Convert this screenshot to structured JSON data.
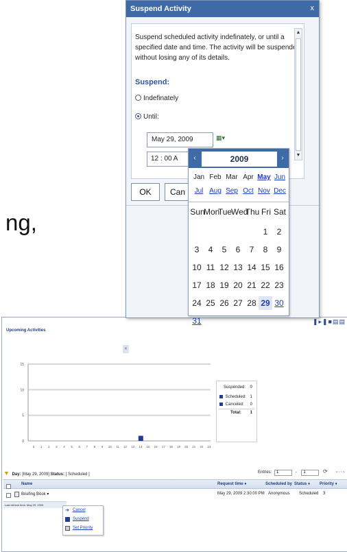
{
  "background": {
    "slide_text": "ng,"
  },
  "dialog": {
    "title": "Suspend Activity",
    "close": "x",
    "description": "Suspend scheduled activity indefinately, or until a specified date and time. The activity will be suspended without losing any of its details.",
    "suspend_label": "Suspend:",
    "options": [
      {
        "label": "Indefinately",
        "selected": false
      },
      {
        "label": "Until:",
        "selected": true
      }
    ],
    "date_value": "May 29, 2009",
    "time_value": "12  :  00    A",
    "buttons": {
      "ok": "OK",
      "cancel_partial": "Can"
    }
  },
  "calendar": {
    "year": "2009",
    "prev_arrow": "‹",
    "next_arrow": "›",
    "months_row1": [
      "Jan",
      "Feb",
      "Mar",
      "Apr",
      "May",
      "Jun"
    ],
    "months_row2": [
      "Jul",
      "Aug",
      "Sep",
      "Oct",
      "Nov",
      "Dec"
    ],
    "selected_month": "May",
    "weekdays": [
      "Sun",
      "Mon",
      "Tue",
      "Wed",
      "Thu",
      "Fri",
      "Sat"
    ],
    "weeks": [
      [
        "",
        "",
        "",
        "",
        "",
        "1",
        "2"
      ],
      [
        "3",
        "4",
        "5",
        "6",
        "7",
        "8",
        "9"
      ],
      [
        "10",
        "11",
        "12",
        "13",
        "14",
        "15",
        "16"
      ],
      [
        "17",
        "18",
        "19",
        "20",
        "21",
        "22",
        "23"
      ],
      [
        "24",
        "25",
        "26",
        "27",
        "28",
        "29",
        "30"
      ],
      [
        "31",
        "",
        "",
        "",
        "",
        "",
        ""
      ]
    ],
    "selected_day": "29",
    "linked_days": [
      "30",
      "31"
    ]
  },
  "upcoming": {
    "title": "Upcoming Activities",
    "legend": [
      {
        "label": "Suspended:",
        "value": "0",
        "color": "#ffffff"
      },
      {
        "label": "Scheduled:",
        "value": "1",
        "color": "#1f3d8a"
      },
      {
        "label": "Canceled:",
        "value": "0",
        "color": "#1f3d8a"
      }
    ],
    "legend_total": {
      "label": "Total:",
      "value": "1"
    },
    "status_line": {
      "day_label": "Day:",
      "day_value": "[May 29, 2009]",
      "status_label": "Status:",
      "status_value": "[ Scheduled ]"
    },
    "entries_label": "Entries:",
    "entries_from": "1",
    "entries_to": "1",
    "columns": [
      "Name",
      "Request time ♦",
      "Scheduled by",
      "Status ♦",
      "Priority ♦"
    ],
    "row": {
      "name": "Briefing Book ▾",
      "request_time": "May 29, 2009 2:30:00 PM",
      "scheduled_by": "Anonymous",
      "status": "Scheduled",
      "priority": "3"
    },
    "footer_note": "Last refresh time: May 29, 2009",
    "context_menu": [
      "Cancel",
      "Suspend",
      "Set Priority"
    ]
  },
  "chart_data": {
    "type": "bar",
    "x": [
      "0",
      "1",
      "2",
      "3",
      "4",
      "5",
      "6",
      "7",
      "8",
      "9",
      "10",
      "11",
      "12",
      "13",
      "14",
      "15",
      "16",
      "17",
      "18",
      "19",
      "20",
      "21",
      "22",
      "23"
    ],
    "series": [
      {
        "name": "Scheduled",
        "values": [
          0,
          0,
          0,
          0,
          0,
          0,
          0,
          0,
          0,
          0,
          0,
          0,
          0,
          0,
          1,
          0,
          0,
          0,
          0,
          0,
          0,
          0,
          0,
          0
        ]
      }
    ],
    "yticks": [
      "15",
      "10",
      "5",
      "0"
    ],
    "ylim": [
      0,
      15
    ],
    "grid": true
  }
}
